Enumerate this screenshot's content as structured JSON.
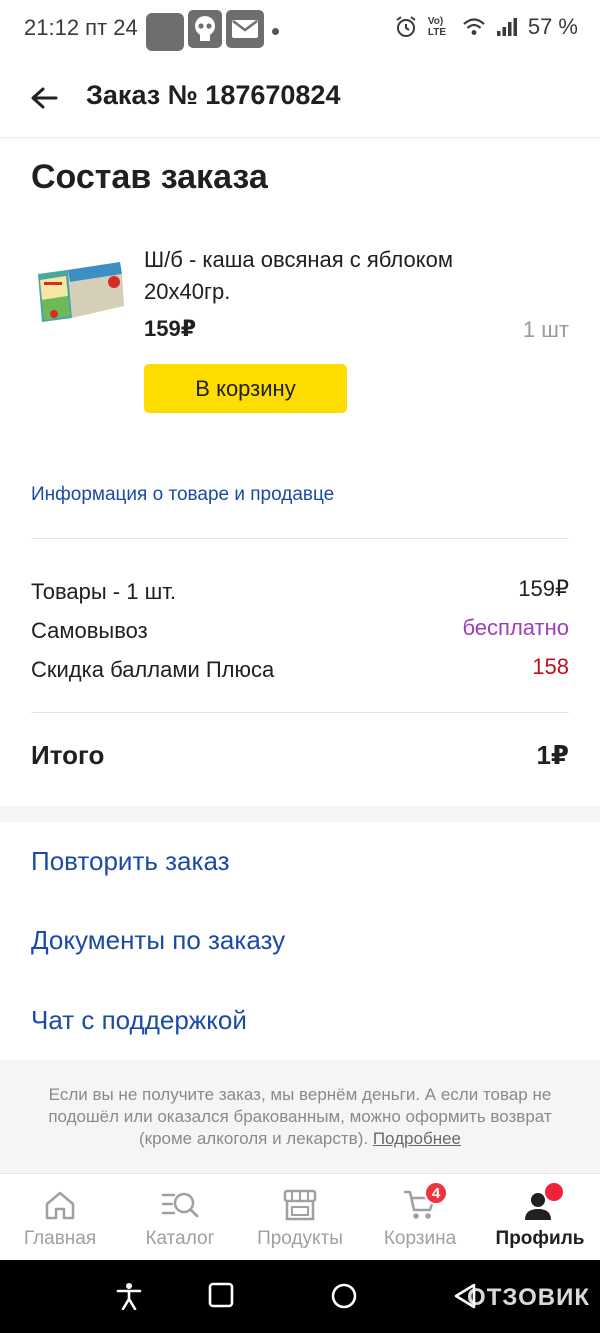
{
  "status_bar": {
    "time": "21:12 пт 24",
    "network": "Vo) LTE",
    "battery": "57 %"
  },
  "header": {
    "title": "Заказ № 187670824"
  },
  "order": {
    "section_title": "Состав заказа",
    "item": {
      "name": "Ш/б - каша овсяная с яблоком 20х40гр.",
      "price": "159₽",
      "quantity": "1 шт",
      "cart_button": "В корзину"
    },
    "info_link": "Информация о товаре и продавце"
  },
  "summary": {
    "goods_label": "Товары - 1 шт.",
    "goods_value": "159₽",
    "pickup_label": "Самовывоз",
    "pickup_value": "бесплатно",
    "discount_label": "Скидка баллами Плюса",
    "discount_value": "158",
    "total_label": "Итого",
    "total_value": "1₽",
    "colors": {
      "free": "#a23bb9",
      "discount": "#c0101c",
      "link": "#1b4ba5",
      "cart_button": "#ffdd00"
    }
  },
  "actions": {
    "repeat": "Повторить заказ",
    "documents": "Документы по заказу",
    "support": "Чат с поддержкой"
  },
  "notice": {
    "text": "Если вы не получите заказ, мы вернём деньги. А если товар не подошёл или оказался бракованным, можно оформить возврат (кроме алкоголя и лекарств).",
    "more": "Подробнее"
  },
  "tabs": [
    {
      "label": "Главная",
      "icon": "home-icon"
    },
    {
      "label": "Каталог",
      "icon": "catalog-search-icon"
    },
    {
      "label": "Продукты",
      "icon": "store-icon"
    },
    {
      "label": "Корзина",
      "icon": "cart-icon",
      "badge": "4"
    },
    {
      "label": "Профиль",
      "icon": "profile-icon",
      "active": true
    }
  ],
  "watermark": "ОТЗОВИК"
}
